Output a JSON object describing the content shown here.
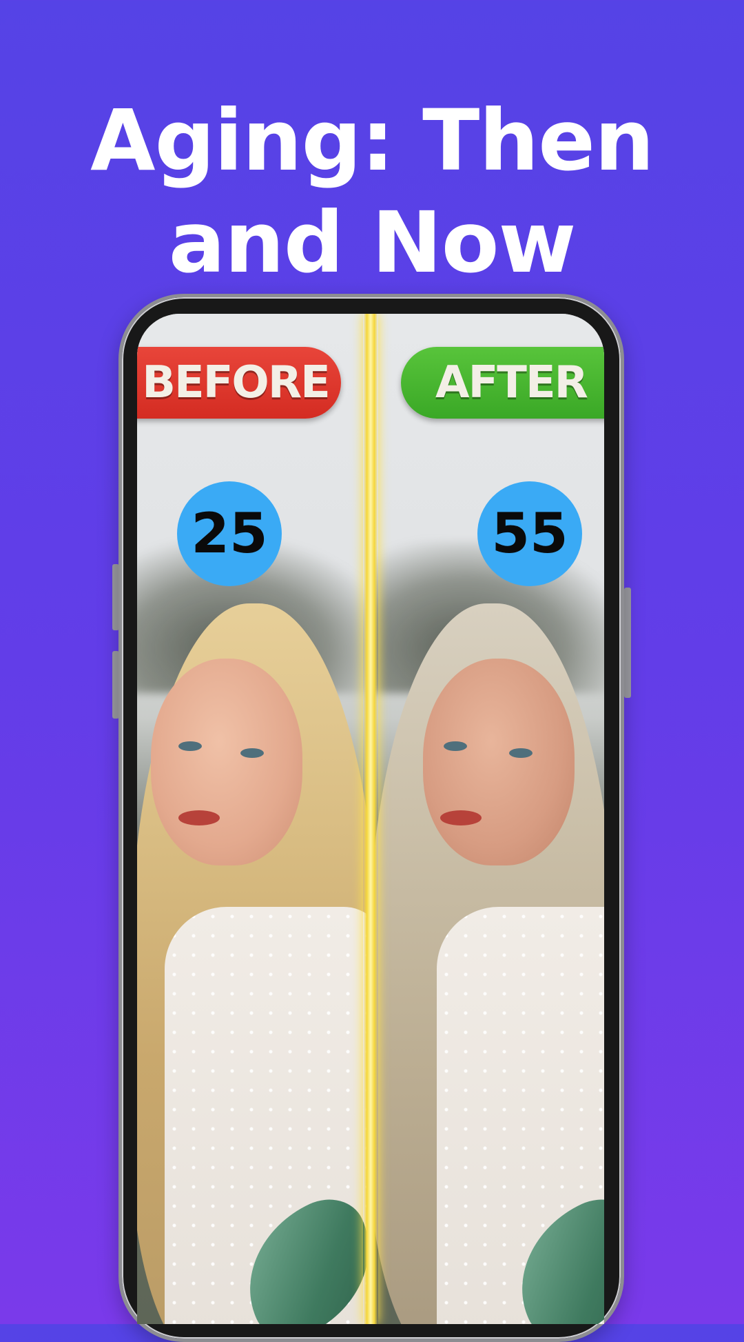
{
  "headline": {
    "line1": "Aging: Then",
    "line2": "and Now"
  },
  "comparison": {
    "before_label": "BEFORE",
    "after_label": "AFTER",
    "before_age": "25",
    "after_age": "55"
  },
  "colors": {
    "background_top": "#5543e6",
    "background_bottom": "#7a3aea",
    "before_pill": "#e0352b",
    "after_pill": "#4cb833",
    "age_badge": "#3aaaf5",
    "divider": "#f5d63a"
  }
}
